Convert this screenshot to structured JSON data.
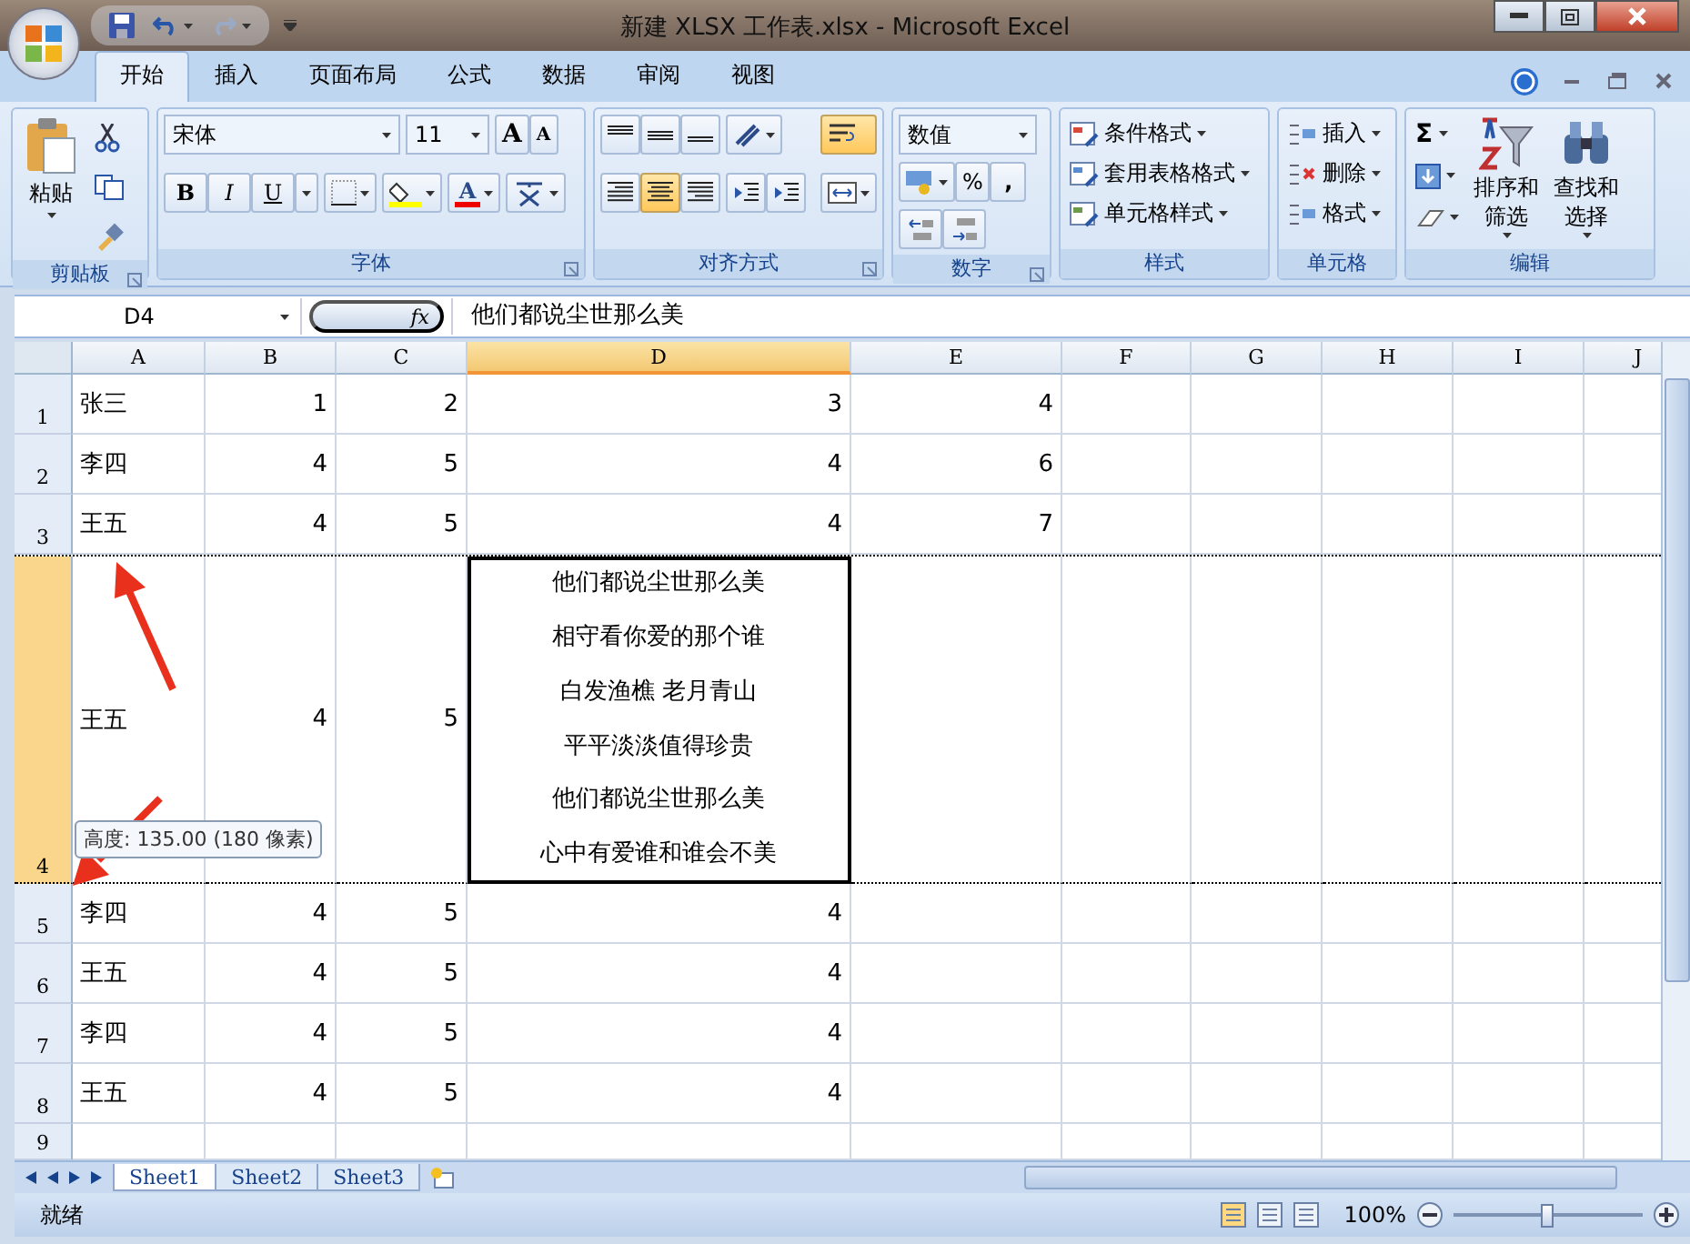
{
  "window": {
    "title": "新建 XLSX 工作表.xlsx - Microsoft Excel"
  },
  "tabs": [
    {
      "label": "开始",
      "selected": true
    },
    {
      "label": "插入",
      "selected": false
    },
    {
      "label": "页面布局",
      "selected": false
    },
    {
      "label": "公式",
      "selected": false
    },
    {
      "label": "数据",
      "selected": false
    },
    {
      "label": "审阅",
      "selected": false
    },
    {
      "label": "视图",
      "selected": false
    }
  ],
  "ribbon": {
    "clipboard": {
      "label": "剪贴板",
      "paste": "粘贴"
    },
    "font": {
      "label": "字体",
      "font_name": "宋体",
      "font_size": "11",
      "grow": "A",
      "shrink": "A",
      "styles": [
        "B",
        "I",
        "U"
      ],
      "font_color": "A"
    },
    "alignment": {
      "label": "对齐方式",
      "horizontal": [
        {
          "selected": false
        },
        {
          "selected": true
        },
        {
          "selected": false
        }
      ],
      "wrap_text": {
        "on": true
      }
    },
    "number": {
      "label": "数字",
      "format": "数值",
      "percent": "%",
      "comma": ","
    },
    "styles": {
      "label": "样式",
      "items": [
        "条件格式",
        "套用表格格式",
        "单元格样式"
      ]
    },
    "cells": {
      "label": "单元格",
      "items": [
        "插入",
        "删除",
        "格式"
      ]
    },
    "editing": {
      "label": "编辑",
      "sum": "Σ",
      "sort": "排序和筛选",
      "find": "查找和选择"
    }
  },
  "formula_bar": {
    "name_box": "D4",
    "fx": "fx",
    "content": "他们都说尘世那么美"
  },
  "columns": [
    {
      "label": "A",
      "selected": false
    },
    {
      "label": "B",
      "selected": false
    },
    {
      "label": "C",
      "selected": false
    },
    {
      "label": "D",
      "selected": true
    },
    {
      "label": "E",
      "selected": false
    },
    {
      "label": "F",
      "selected": false
    },
    {
      "label": "G",
      "selected": false
    },
    {
      "label": "H",
      "selected": false
    },
    {
      "label": "I",
      "selected": false
    },
    {
      "label": "J",
      "selected": false
    }
  ],
  "rows": [
    {
      "header": "1",
      "selected": false,
      "resizing": false,
      "cells": [
        "张三",
        "1",
        "2",
        "3",
        "4"
      ]
    },
    {
      "header": "2",
      "selected": false,
      "resizing": false,
      "cells": [
        "李四",
        "4",
        "5",
        "4",
        "6"
      ]
    },
    {
      "header": "3",
      "selected": false,
      "resizing": false,
      "cells": [
        "王五",
        "4",
        "5",
        "4",
        "7"
      ]
    },
    {
      "header": "4",
      "selected": true,
      "resizing": true,
      "cells": [
        "王五",
        "4",
        "5",
        [
          "他们都说尘世那么美",
          "相守看你爱的那个谁",
          "白发渔樵  老月青山",
          "平平淡淡值得珍贵",
          "他们都说尘世那么美",
          "心中有爱谁和谁会不美"
        ]
      ]
    },
    {
      "header": "5",
      "selected": false,
      "resizing": false,
      "cells": [
        "李四",
        "4",
        "5",
        "4"
      ]
    },
    {
      "header": "6",
      "selected": false,
      "resizing": false,
      "cells": [
        "王五",
        "4",
        "5",
        "4"
      ]
    },
    {
      "header": "7",
      "selected": false,
      "resizing": false,
      "cells": [
        "李四",
        "4",
        "5",
        "4"
      ]
    },
    {
      "header": "8",
      "selected": false,
      "resizing": false,
      "cells": [
        "王五",
        "4",
        "5",
        "4"
      ]
    },
    {
      "header": "9",
      "selected": false,
      "resizing": false
    }
  ],
  "tooltip": "高度: 135.00 (180 像素)",
  "sheet_tabs": [
    {
      "label": "Sheet1",
      "selected": true
    },
    {
      "label": "Sheet2",
      "selected": false
    },
    {
      "label": "Sheet3",
      "selected": false
    }
  ],
  "status_bar": {
    "status": "就绪",
    "zoom": "100%",
    "zoom_slider": {
      "level": 0.5
    }
  }
}
